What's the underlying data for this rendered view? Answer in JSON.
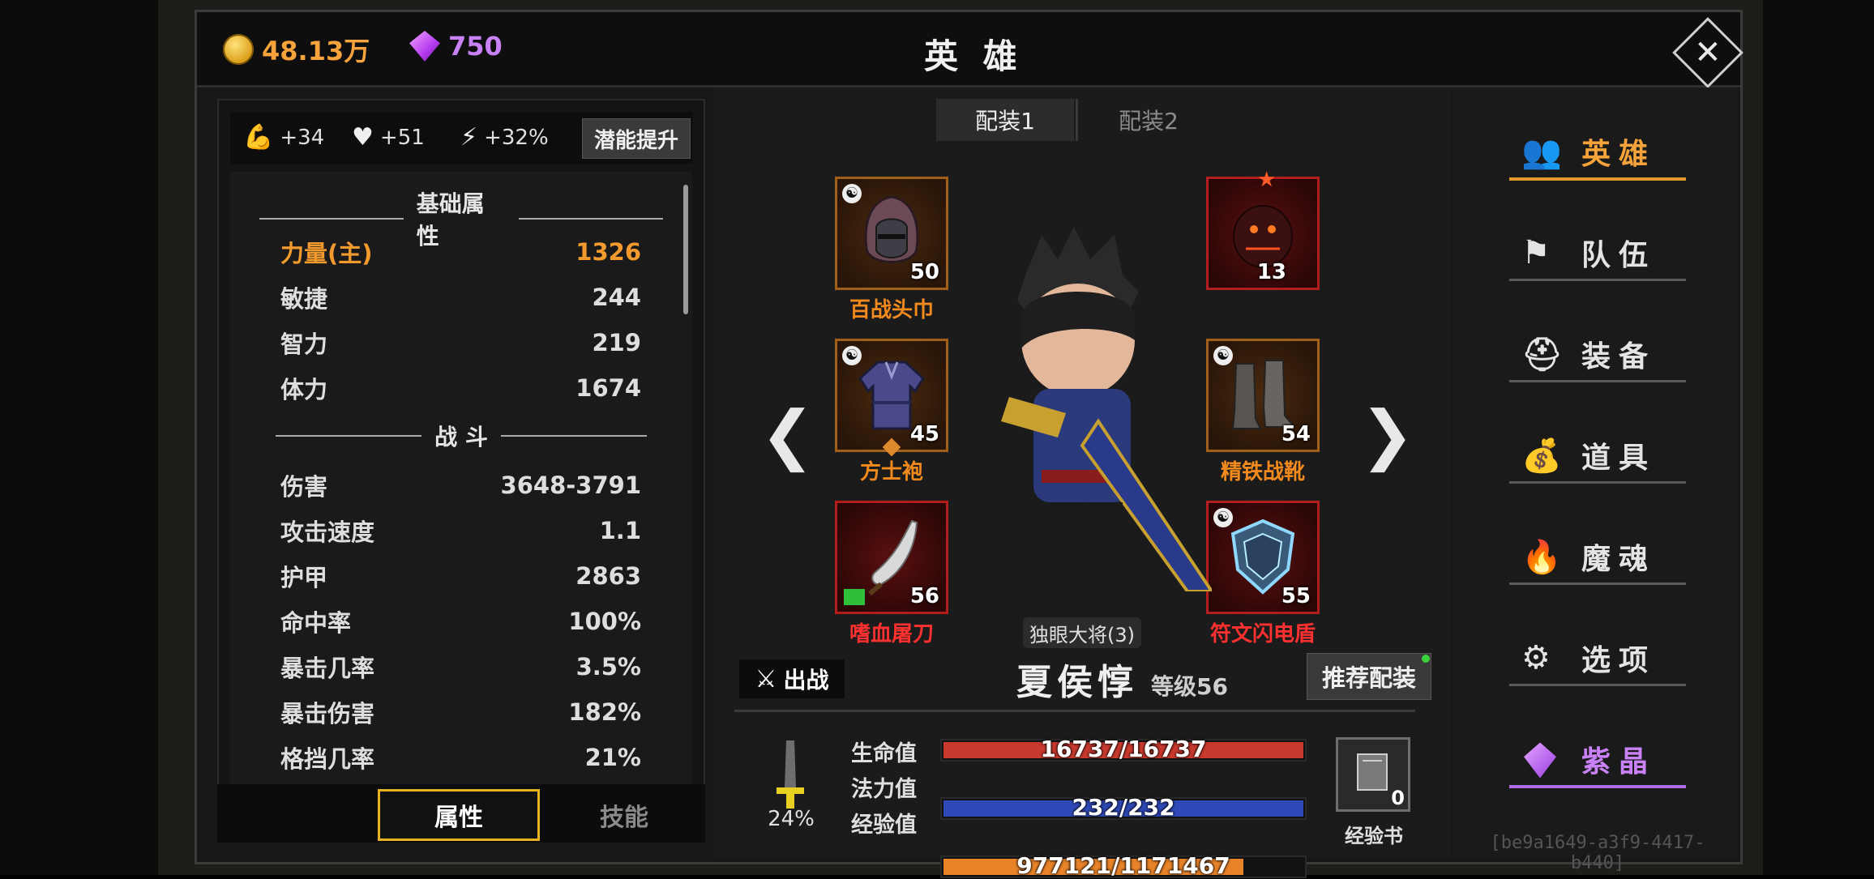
{
  "header": {
    "gold": "48.13万",
    "gems": "750",
    "title": "英 雄",
    "close_icon": "close-icon"
  },
  "buffs": [
    {
      "icon": "strength-arm-icon",
      "value": "+34"
    },
    {
      "icon": "heart-icon",
      "value": "+51"
    },
    {
      "icon": "lightning-icon",
      "value": "+32%"
    }
  ],
  "potential_button": "潜能提升",
  "sections": {
    "basic": "基础属性",
    "combat": "战 斗"
  },
  "basic_stats": [
    {
      "label": "力量(主)",
      "value": "1326"
    },
    {
      "label": "敏捷",
      "value": "244"
    },
    {
      "label": "智力",
      "value": "219"
    },
    {
      "label": "体力",
      "value": "1674"
    }
  ],
  "combat_stats": [
    {
      "label": "伤害",
      "value": "3648-3791"
    },
    {
      "label": "攻击速度",
      "value": "1.1"
    },
    {
      "label": "护甲",
      "value": "2863"
    },
    {
      "label": "命中率",
      "value": "100%"
    },
    {
      "label": "暴击几率",
      "value": "3.5%"
    },
    {
      "label": "暴击伤害",
      "value": "182%"
    },
    {
      "label": "格挡几率",
      "value": "21%"
    }
  ],
  "bottom_tabs": {
    "attributes": "属性",
    "skills": "技能"
  },
  "loadout_tabs": [
    "配装1",
    "配装2"
  ],
  "equipment": {
    "helmet": {
      "name": "百战头巾",
      "level": "50"
    },
    "armor": {
      "name": "方士袍",
      "level": "45"
    },
    "weapon": {
      "name": "嗜血屠刀",
      "level": "56"
    },
    "pet": {
      "level": "13"
    },
    "boots": {
      "name": "精铁战靴",
      "level": "54"
    },
    "shield": {
      "name": "符文闪电盾",
      "level": "55"
    }
  },
  "nav_arrows": {
    "prev": "❮",
    "next": "❯"
  },
  "set_label": "独眼大将(3)",
  "battle_button": "出战",
  "hero": {
    "name": "夏侯惇",
    "level": "等级56"
  },
  "recommend_button": "推荐配装",
  "bars": {
    "hp": {
      "label": "生命值",
      "text": "16737/16737",
      "fraction": 1.0,
      "color": "#c8392e"
    },
    "mp": {
      "label": "法力值",
      "text": "232/232",
      "fraction": 1.0,
      "color": "#2f49b8"
    },
    "exp": {
      "label": "经验值",
      "text": "977121/1171467",
      "fraction": 0.834,
      "color": "#e8832a"
    }
  },
  "weapon_percent": "24%",
  "exp_book": {
    "label": "经验书",
    "count": "0"
  },
  "nav": [
    {
      "icon": "hero-users-icon",
      "label": "英雄"
    },
    {
      "icon": "flag-icon",
      "label": "队伍"
    },
    {
      "icon": "helmet-icon",
      "label": "装备"
    },
    {
      "icon": "bag-icon",
      "label": "道具"
    },
    {
      "icon": "flame-icon",
      "label": "魔魂"
    },
    {
      "icon": "gear-icon",
      "label": "选项"
    },
    {
      "icon": "purple-gem-icon",
      "label": "紫晶"
    }
  ],
  "watermark": "[be9a1649-a3f9-4417-b440]",
  "colors": {
    "accent_orange": "#f29a2e",
    "purple": "#c982f5",
    "slot_orange": "#a0601a",
    "slot_red": "#b21e1e"
  }
}
